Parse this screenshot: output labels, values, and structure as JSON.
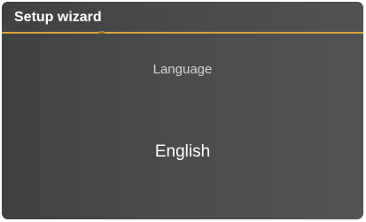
{
  "header": {
    "title": "Setup wizard"
  },
  "setting": {
    "label": "Language",
    "value": "English"
  },
  "colors": {
    "accent": "#d7a53a",
    "background": "#48494b",
    "text_primary": "#ffffff",
    "text_secondary": "#d4d4d4"
  }
}
